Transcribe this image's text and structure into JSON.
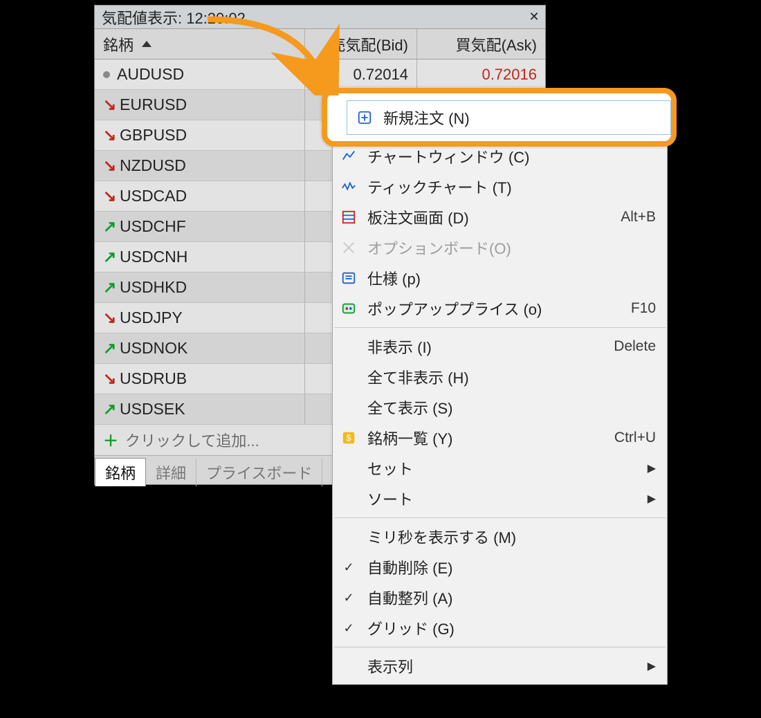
{
  "window": {
    "title": "気配値表示: 12:20:02"
  },
  "columns": {
    "symbol": "銘柄",
    "bid": "売気配(Bid)",
    "ask": "買気配(Ask)"
  },
  "rows": [
    {
      "dir": "none",
      "symbol": "AUDUSD",
      "bid": "0.72014",
      "ask": "0.72016",
      "ask_red": true
    },
    {
      "dir": "down",
      "symbol": "EURUSD"
    },
    {
      "dir": "down",
      "symbol": "GBPUSD"
    },
    {
      "dir": "down",
      "symbol": "NZDUSD"
    },
    {
      "dir": "down",
      "symbol": "USDCAD"
    },
    {
      "dir": "up",
      "symbol": "USDCHF"
    },
    {
      "dir": "up",
      "symbol": "USDCNH"
    },
    {
      "dir": "up",
      "symbol": "USDHKD"
    },
    {
      "dir": "down",
      "symbol": "USDJPY"
    },
    {
      "dir": "up",
      "symbol": "USDNOK"
    },
    {
      "dir": "down",
      "symbol": "USDRUB"
    },
    {
      "dir": "up",
      "symbol": "USDSEK"
    }
  ],
  "add_row": "クリックして追加...",
  "tabs": {
    "symbols": "銘柄",
    "details": "詳細",
    "priceboard": "プライスボード"
  },
  "menu": {
    "new_order": "新規注文 (N)",
    "chart_window": "チャートウィンドウ (C)",
    "tick_chart": "ティックチャート (T)",
    "depth": "板注文画面 (D)",
    "depth_sc": "Alt+B",
    "option_board": "オプションボード(O)",
    "spec": "仕様 (p)",
    "popup_price": "ポップアッププライス (o)",
    "popup_sc": "F10",
    "hide": "非表示 (I)",
    "hide_sc": "Delete",
    "hide_all": "全て非表示 (H)",
    "show_all": "全て表示 (S)",
    "symbol_list": "銘柄一覧 (Y)",
    "symbol_list_sc": "Ctrl+U",
    "set": "セット",
    "sort": "ソート",
    "show_ms": "ミリ秒を表示する (M)",
    "auto_delete": "自動削除 (E)",
    "auto_arrange": "自動整列 (A)",
    "grid": "グリッド (G)",
    "columns": "表示列"
  }
}
